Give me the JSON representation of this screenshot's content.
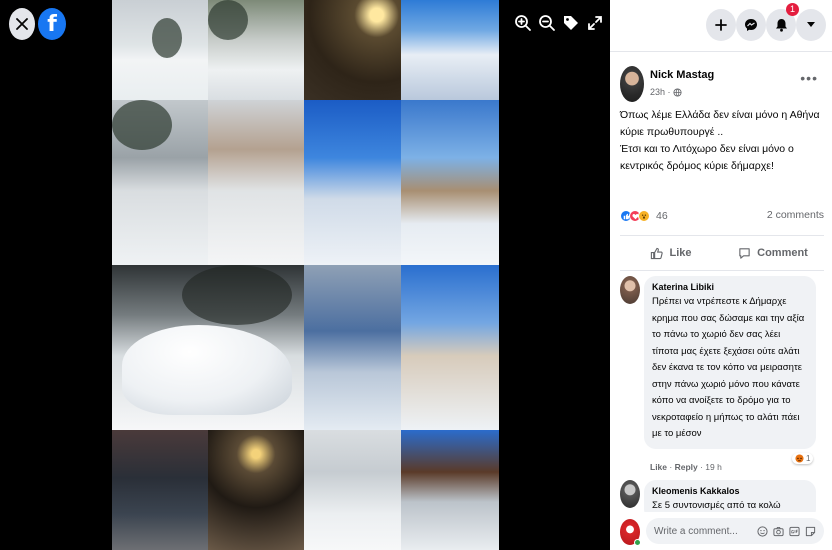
{
  "header": {
    "close_icon": "close-icon",
    "logo": "facebook-logo",
    "viewer_tools": [
      "zoom-in-icon",
      "zoom-out-icon",
      "tag-icon",
      "fullscreen-icon"
    ],
    "right_buttons": [
      "plus-icon",
      "messenger-icon",
      "bell-icon",
      "caret-down-icon"
    ],
    "notification_count": "1"
  },
  "post": {
    "author": "Nick Mastag",
    "time": "23h ·",
    "text_line1": "Όπως λέμε Ελλάδα δεν είναι μόνο η Αθήνα κύριε πρωθυπουργέ ..",
    "text_line2": "Έτσι και το Λιτόχωρο δεν είναι μόνο ο κεντρικός δρόμος κύριε δήμαρχε!",
    "reaction_count": "46",
    "comments_count": "2 comments",
    "like_label": "Like",
    "comment_label": "Comment"
  },
  "comments": [
    {
      "author": "Katerina Libiki",
      "text": "Πρέπει να ντρέπεστε κ Δήμαρχε κρημα που σας δώσαμε και την αξία το πάνω το χωριό δεν σας λέει τίποτα μας έχετε ξεχάσει ούτε αλάτι δεν έκανα τε τον κόπο να μειρασητε στην πάνω χωριό μόνο που κάνατε κόπο να ανοίξετε το δρόμο για το νεκροταφείο η μήπως το αλάτι πάει με το μέσον",
      "like": "Like",
      "reply": "Reply",
      "time": "19 h",
      "reaction_count": "1"
    },
    {
      "author": "Kleomenis Kakkalos",
      "text": "Σε 5 συντονισμές από τα κολώ"
    }
  ],
  "composer": {
    "placeholder": "Write a comment..."
  },
  "colors": {
    "facebook_blue": "#1877f2",
    "badge_red": "#e41e3f",
    "text_secondary": "#65676b"
  }
}
